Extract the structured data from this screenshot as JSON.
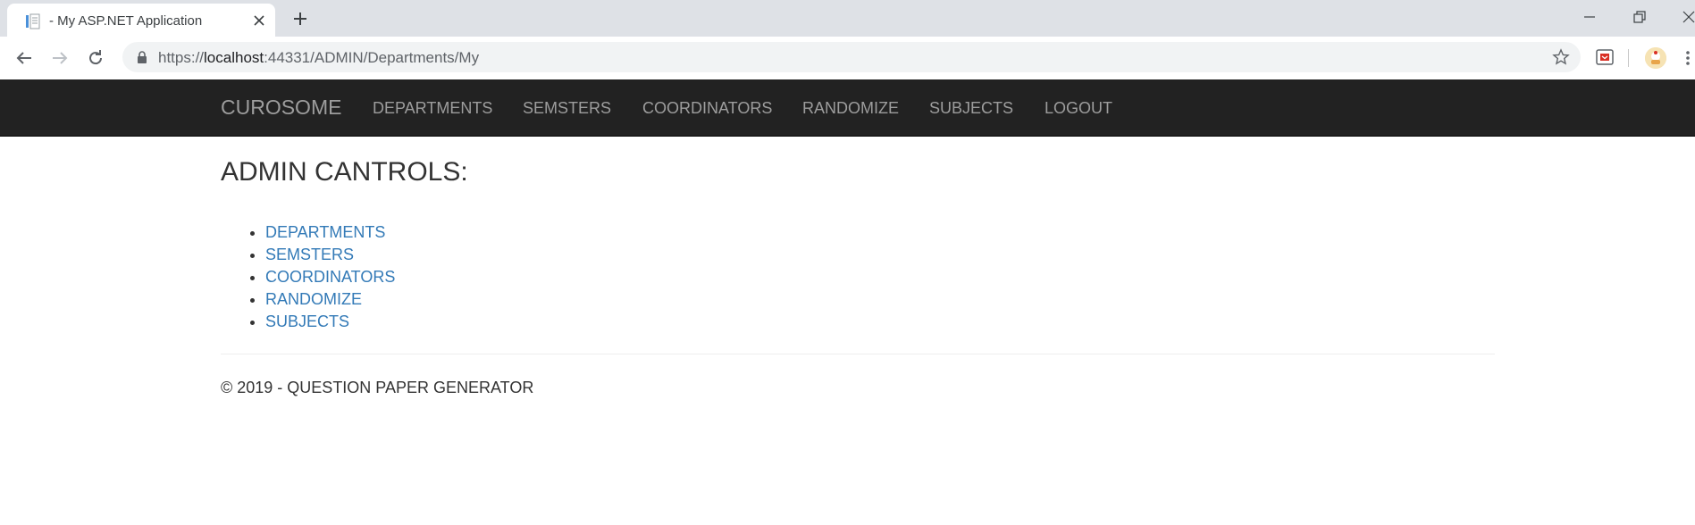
{
  "browser": {
    "tab_title": "- My ASP.NET Application",
    "url_scheme": "https://",
    "url_host": "localhost",
    "url_rest": ":44331/ADMIN/Departments/My"
  },
  "navbar": {
    "brand": "CUROSOME",
    "links": [
      {
        "label": "DEPARTMENTS"
      },
      {
        "label": "SEMSTERS"
      },
      {
        "label": "COORDINATORS"
      },
      {
        "label": "RANDOMIZE"
      },
      {
        "label": "SUBJECTS"
      },
      {
        "label": "LOGOUT"
      }
    ]
  },
  "main": {
    "heading": "ADMIN CANTROLS:",
    "links": [
      {
        "label": "DEPARTMENTS"
      },
      {
        "label": "SEMSTERS"
      },
      {
        "label": "COORDINATORS"
      },
      {
        "label": "RANDOMIZE"
      },
      {
        "label": "SUBJECTS"
      }
    ]
  },
  "footer": {
    "text": "© 2019 - QUESTION PAPER GENERATOR"
  },
  "colors": {
    "navbar_bg": "#222222",
    "navbar_text": "#9d9d9d",
    "link": "#337ab7",
    "text": "#333333"
  }
}
